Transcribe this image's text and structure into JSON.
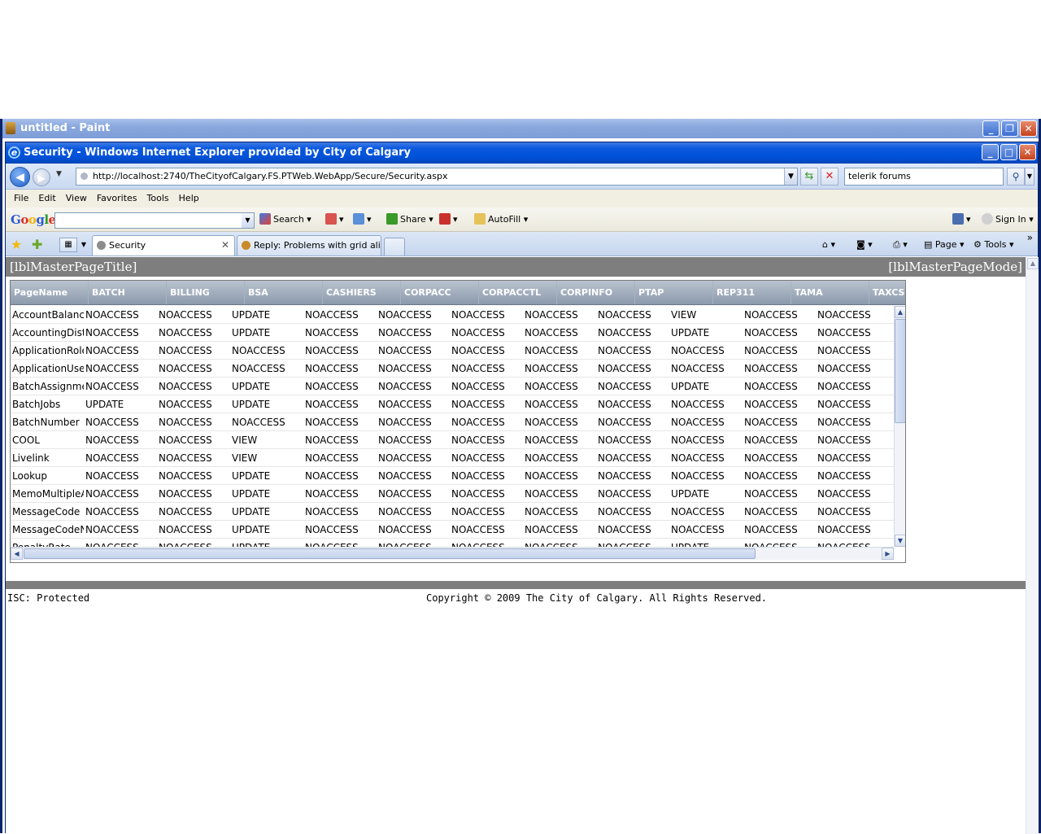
{
  "paint_window": {
    "title": "untitled - Paint"
  },
  "ie_window": {
    "title": "Security - Windows Internet Explorer provided by City of Calgary"
  },
  "addressbar": {
    "url": "http://localhost:2740/TheCityofCalgary.FS.PTWeb.WebApp/Secure/Security.aspx",
    "search_value": "telerik forums"
  },
  "menubar": {
    "items": [
      "File",
      "Edit",
      "View",
      "Favorites",
      "Tools",
      "Help"
    ]
  },
  "googlebar": {
    "logo": [
      "G",
      "o",
      "o",
      "g",
      "l",
      "e"
    ],
    "search_label": "Search",
    "share_label": "Share",
    "autofill_label": "AutoFill",
    "signin_label": "Sign In"
  },
  "tabs": [
    {
      "label": "Security",
      "active": true
    },
    {
      "label": "Reply: Problems with grid alig...",
      "active": false
    }
  ],
  "command_bar": {
    "page_label": "Page",
    "tools_label": "Tools"
  },
  "page": {
    "master_title": "[lblMasterPageTitle]",
    "master_mode": "[lblMasterPageMode]",
    "footer_left": "ISC: Protected",
    "footer_center": "Copyright © 2009 The City of Calgary. All Rights Reserved."
  },
  "grid": {
    "columns": [
      "PageName",
      "BATCH",
      "BILLING",
      "BSA",
      "CASHIERS",
      "CORPACC",
      "CORPACCTL",
      "CORPINFO",
      "PTAP",
      "REP311",
      "TAMA",
      "TAXCSR"
    ],
    "rows": [
      [
        "AccountBalanc",
        "NOACCESS",
        "NOACCESS",
        "UPDATE",
        "NOACCESS",
        "NOACCESS",
        "NOACCESS",
        "NOACCESS",
        "NOACCESS",
        "VIEW",
        "NOACCESS",
        "NOACCESS"
      ],
      [
        "AccountingDist",
        "NOACCESS",
        "NOACCESS",
        "UPDATE",
        "NOACCESS",
        "NOACCESS",
        "NOACCESS",
        "NOACCESS",
        "NOACCESS",
        "UPDATE",
        "NOACCESS",
        "NOACCESS"
      ],
      [
        "ApplicationRole",
        "NOACCESS",
        "NOACCESS",
        "NOACCESS",
        "NOACCESS",
        "NOACCESS",
        "NOACCESS",
        "NOACCESS",
        "NOACCESS",
        "NOACCESS",
        "NOACCESS",
        "NOACCESS"
      ],
      [
        "ApplicationUsei",
        "NOACCESS",
        "NOACCESS",
        "NOACCESS",
        "NOACCESS",
        "NOACCESS",
        "NOACCESS",
        "NOACCESS",
        "NOACCESS",
        "NOACCESS",
        "NOACCESS",
        "NOACCESS"
      ],
      [
        "BatchAssignme",
        "NOACCESS",
        "NOACCESS",
        "UPDATE",
        "NOACCESS",
        "NOACCESS",
        "NOACCESS",
        "NOACCESS",
        "NOACCESS",
        "UPDATE",
        "NOACCESS",
        "NOACCESS"
      ],
      [
        "BatchJobs",
        "UPDATE",
        "NOACCESS",
        "UPDATE",
        "NOACCESS",
        "NOACCESS",
        "NOACCESS",
        "NOACCESS",
        "NOACCESS",
        "NOACCESS",
        "NOACCESS",
        "NOACCESS"
      ],
      [
        "BatchNumber",
        "NOACCESS",
        "NOACCESS",
        "NOACCESS",
        "NOACCESS",
        "NOACCESS",
        "NOACCESS",
        "NOACCESS",
        "NOACCESS",
        "NOACCESS",
        "NOACCESS",
        "NOACCESS"
      ],
      [
        "COOL",
        "NOACCESS",
        "NOACCESS",
        "VIEW",
        "NOACCESS",
        "NOACCESS",
        "NOACCESS",
        "NOACCESS",
        "NOACCESS",
        "NOACCESS",
        "NOACCESS",
        "NOACCESS"
      ],
      [
        "Livelink",
        "NOACCESS",
        "NOACCESS",
        "VIEW",
        "NOACCESS",
        "NOACCESS",
        "NOACCESS",
        "NOACCESS",
        "NOACCESS",
        "NOACCESS",
        "NOACCESS",
        "NOACCESS"
      ],
      [
        "Lookup",
        "NOACCESS",
        "NOACCESS",
        "UPDATE",
        "NOACCESS",
        "NOACCESS",
        "NOACCESS",
        "NOACCESS",
        "NOACCESS",
        "NOACCESS",
        "NOACCESS",
        "NOACCESS"
      ],
      [
        "MemoMultipleA",
        "NOACCESS",
        "NOACCESS",
        "UPDATE",
        "NOACCESS",
        "NOACCESS",
        "NOACCESS",
        "NOACCESS",
        "NOACCESS",
        "UPDATE",
        "NOACCESS",
        "NOACCESS"
      ],
      [
        "MessageCode",
        "NOACCESS",
        "NOACCESS",
        "UPDATE",
        "NOACCESS",
        "NOACCESS",
        "NOACCESS",
        "NOACCESS",
        "NOACCESS",
        "NOACCESS",
        "NOACCESS",
        "NOACCESS"
      ],
      [
        "MessageCodeN",
        "NOACCESS",
        "NOACCESS",
        "UPDATE",
        "NOACCESS",
        "NOACCESS",
        "NOACCESS",
        "NOACCESS",
        "NOACCESS",
        "NOACCESS",
        "NOACCESS",
        "NOACCESS"
      ],
      [
        "PenaltyRate",
        "NOACCESS",
        "NOACCESS",
        "UPDATE",
        "NOACCESS",
        "NOACCESS",
        "NOACCESS",
        "NOACCESS",
        "NOACCESS",
        "UPDATE",
        "NOACCESS",
        "NOACCESS"
      ]
    ]
  }
}
